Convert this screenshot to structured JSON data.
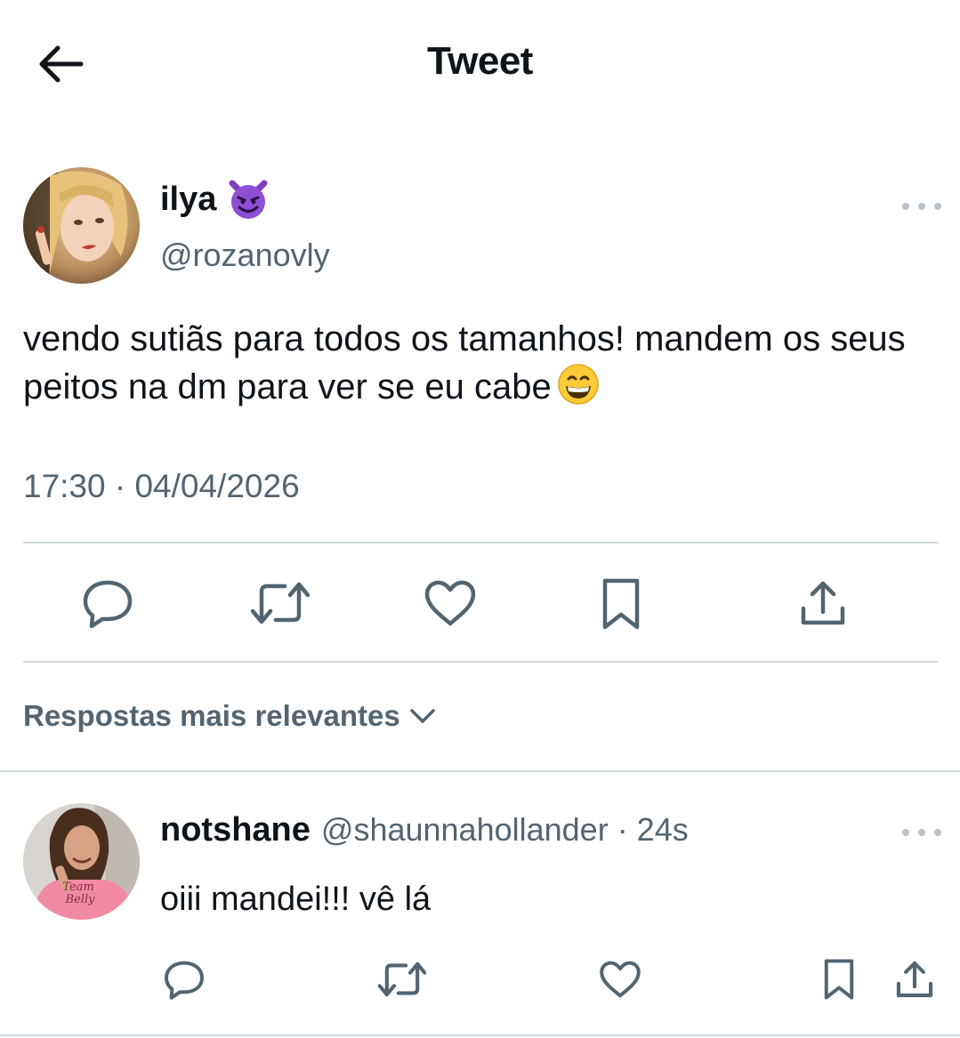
{
  "header": {
    "title": "Tweet",
    "back_icon": "arrow-left-icon"
  },
  "tweet": {
    "author_name": "ilya",
    "author_emoji": "smiling-imp-emoji",
    "handle": "@rozanovly",
    "text": "vendo sutiãs para todos os tamanhos! mandem os seus peitos na dm para ver se eu cabe",
    "text_emoji": "grinning-face-emoji",
    "timestamp": "17:30 · 04/04/2026",
    "actions": [
      "reply-icon",
      "retweet-icon",
      "like-icon",
      "bookmark-icon",
      "share-icon"
    ]
  },
  "replies_sort": {
    "label": "Respostas mais relevantes",
    "icon": "chevron-down-icon"
  },
  "reply": {
    "author_name": "notshane",
    "meta": "@shaunnahollander · 24s",
    "text": "oiii mandei!!! vê lá",
    "avatar_shirt_text": "Team Belly",
    "actions": [
      "reply-icon",
      "retweet-icon",
      "like-icon",
      "bookmark-icon",
      "share-icon"
    ]
  },
  "colors": {
    "text": "#0f1419",
    "secondary": "#536471",
    "divider": "#cfd9de",
    "icon": "#536471"
  }
}
